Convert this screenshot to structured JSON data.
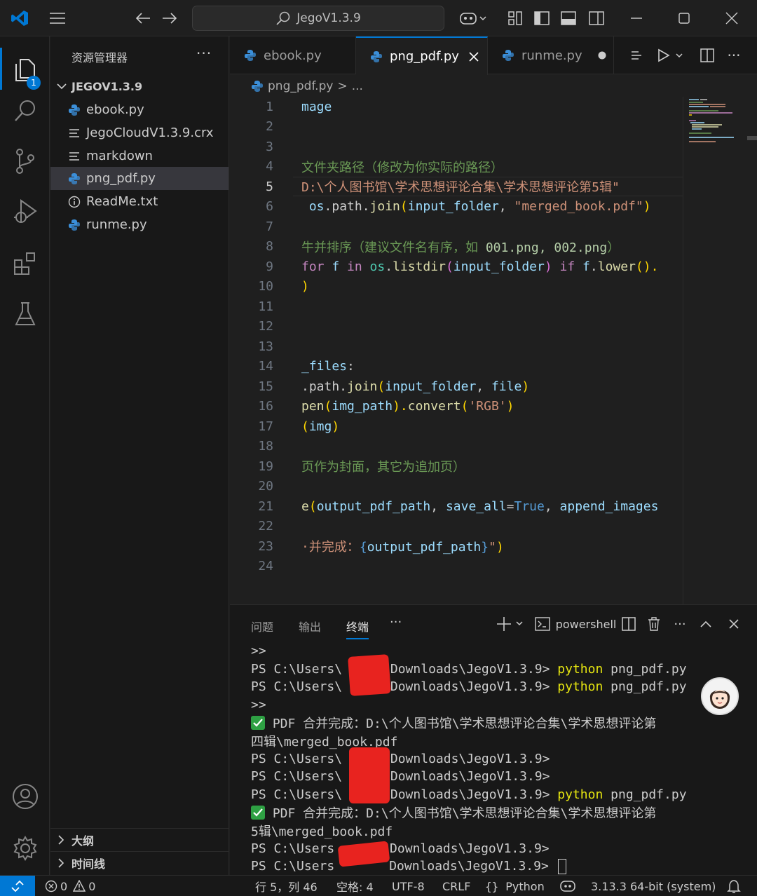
{
  "titlebar": {
    "search_text": "JegoV1.3.9"
  },
  "activity": {
    "explorer_badge": "1"
  },
  "sidebar": {
    "title": "资源管理器",
    "more": "···",
    "folder": "JEGOV1.3.9",
    "files": [
      {
        "name": "ebook.py",
        "icon": "python-icon"
      },
      {
        "name": "JegoCloudV1.3.9.crx",
        "icon": "lines-icon"
      },
      {
        "name": "markdown",
        "icon": "lines-icon"
      },
      {
        "name": "png_pdf.py",
        "icon": "python-icon"
      },
      {
        "name": "ReadMe.txt",
        "icon": "info-icon"
      },
      {
        "name": "runme.py",
        "icon": "python-icon"
      }
    ],
    "outline": "大纲",
    "timeline": "时间线"
  },
  "tabs": [
    {
      "label": "ebook.py"
    },
    {
      "label": "png_pdf.py"
    },
    {
      "label": "runme.py"
    }
  ],
  "breadcrumb": {
    "file": "png_pdf.py",
    "sep": ">",
    "rest": "..."
  },
  "editor": {
    "line_numbers": [
      "1",
      "2",
      "3",
      "4",
      "5",
      "6",
      "7",
      "8",
      "9",
      "10",
      "11",
      "12",
      "13",
      "14",
      "15",
      "16",
      "17",
      "18",
      "19",
      "20",
      "21",
      "22",
      "23",
      "24"
    ],
    "code": {
      "l1": "mage",
      "l4": "文件夹路径（修改为你实际的路径）",
      "l5": "D:\\个人图书馆\\学术思想评论合集\\学术思想评论第5辑\"",
      "l6_a": " os",
      "l6_b": ".path.",
      "l6_c": "join",
      "l6_d": "(",
      "l6_e": "input_folder",
      "l6_f": ", ",
      "l6_g": "\"merged_book.pdf\"",
      "l6_h": ")",
      "l8_a": "牛并排序（建议文件名有序，如 ",
      "l8_b": "001.png, 002.png",
      "l8_c": "）",
      "l9_a": "for",
      "l9_b": " f ",
      "l9_c": "in",
      "l9_d": " os",
      "l9_e": ".",
      "l9_f": "listdir",
      "l9_g": "(",
      "l9_h": "input_folder",
      "l9_i": ") ",
      "l9_j": "if",
      "l9_k": " f",
      "l9_l": ".",
      "l9_m": "lower",
      "l9_n": "().",
      "l10": ")",
      "l14_a": "_files",
      "l14_b": ":",
      "l15_a": ".path.",
      "l15_b": "join",
      "l15_c": "(",
      "l15_d": "input_folder",
      "l15_e": ", ",
      "l15_f": "file",
      "l15_g": ")",
      "l16_a": "pen",
      "l16_b": "(",
      "l16_c": "img_path",
      "l16_d": ").",
      "l16_e": "convert",
      "l16_f": "(",
      "l16_g": "'RGB'",
      "l16_h": ")",
      "l17_a": "(",
      "l17_b": "img",
      "l17_c": ")",
      "l19": "页作为封面，其它为追加页）",
      "l21_a": "e",
      "l21_b": "(",
      "l21_c": "output_pdf_path",
      "l21_d": ", ",
      "l21_e": "save_all",
      "l21_f": "=",
      "l21_g": "True",
      "l21_h": ", ",
      "l21_i": "append_images",
      "l23_a": "·并完成：",
      "l23_b": "{",
      "l23_c": "output_pdf_path",
      "l23_d": "}",
      "l23_e": "\"",
      "l23_f": ")"
    }
  },
  "panel": {
    "tabs": [
      "问题",
      "输出",
      "终端",
      "···"
    ],
    "shell": "powershell",
    "terminal": [
      {
        "pre": ">>",
        "cmd": "",
        "rest": ""
      },
      {
        "pre": "PS C:\\Users\\",
        "mid": "\\Downloads\\JegoV1.3.9> ",
        "cmd": "python",
        "rest": " png_pdf.py"
      },
      {
        "pre": "PS C:\\Users\\",
        "mid": "\\Downloads\\JegoV1.3.9> ",
        "cmd": "python",
        "rest": " png_pdf.py"
      },
      {
        "pre": ">>",
        "cmd": "",
        "rest": ""
      },
      {
        "pre": " PDF 合并完成：D:\\个人图书馆\\学术思想评论合集\\学术思想评论第",
        "cmd": "",
        "rest": ""
      },
      {
        "pre": "四辑\\merged_book.pdf",
        "cmd": "",
        "rest": ""
      },
      {
        "pre": "PS C:\\Users\\",
        "mid": "\\Downloads\\JegoV1.3.9>",
        "cmd": "",
        "rest": ""
      },
      {
        "pre": "PS C:\\Users\\",
        "mid": "\\Downloads\\JegoV1.3.9>",
        "cmd": "",
        "rest": ""
      },
      {
        "pre": "PS C:\\Users\\",
        "mid": "\\Downloads\\JegoV1.3.9> ",
        "cmd": "python",
        "rest": " png_pdf.py"
      },
      {
        "pre": " PDF 合并完成：D:\\个人图书馆\\学术思想评论合集\\学术思想评论第",
        "cmd": "",
        "rest": ""
      },
      {
        "pre": "5辑\\merged_book.pdf",
        "cmd": "",
        "rest": ""
      },
      {
        "pre": "PS C:\\Users",
        "mid": "\\Downloads\\JegoV1.3.9>",
        "cmd": "",
        "rest": ""
      },
      {
        "pre": "PS C:\\Users",
        "mid": "Downloads\\JegoV1.3.9> ",
        "cmd": "",
        "rest": ""
      }
    ]
  },
  "statusbar": {
    "errors": "0",
    "warnings": "0",
    "position": "行 5，列 46",
    "spaces": "空格: 4",
    "encoding": "UTF-8",
    "eol": "CRLF",
    "language": "Python",
    "interpreter": "3.13.3 64-bit (system)"
  },
  "colors": {
    "accent": "#0078d4",
    "editor_bg": "#1f1f1f",
    "sidebar_bg": "#181818",
    "success": "#2ea043"
  }
}
